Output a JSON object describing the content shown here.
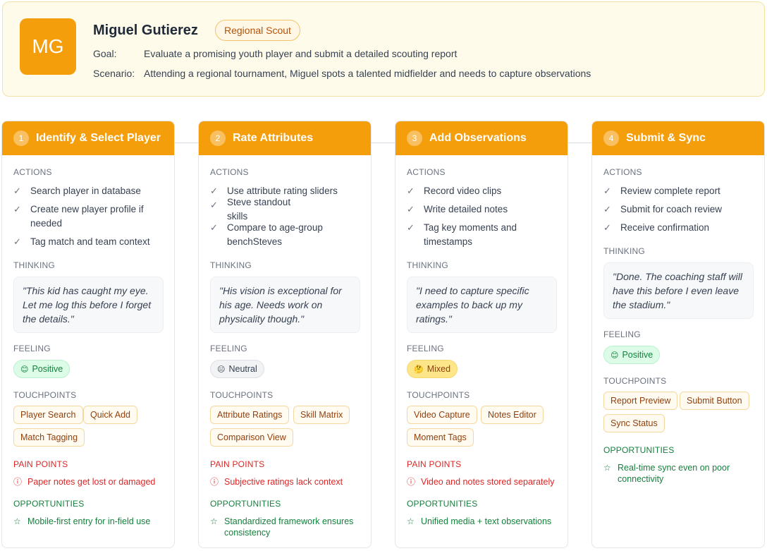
{
  "persona": {
    "initials": "MG",
    "name": "Miguel Gutierez",
    "role": "Regional Scout",
    "goal_label": "Goal:",
    "goal": "Evaluate a promising youth player and submit a detailed scouting report",
    "scenario_label": "Scenario:",
    "scenario": "Attending a regional tournament, Miguel spots a talented midfielder and needs to capture observations"
  },
  "labels": {
    "actions": "ACTIONS",
    "thinking": "THINKING",
    "feeling": "FEELING",
    "touchpoints": "TOUCHPOINTS",
    "pain_points": "PAIN POINTS",
    "opportunities": "OPPORTUNITIES"
  },
  "icons": {
    "check": "check-icon",
    "pain": "alert-circle-icon",
    "opportunity": "star-outline-icon"
  },
  "colors": {
    "accent": "#f59e0b",
    "pain": "#dc2626",
    "opportunity": "#15803d"
  },
  "stages": [
    {
      "number": "1",
      "title": "Identify & Select Player",
      "actions": [
        "Search player in database",
        "Create new player profile if needed",
        "Tag match and team context"
      ],
      "thinking": "\"This kid has caught my eye. Let me log this before I forget the details.\"",
      "feeling": "Positive",
      "feeling_emoji": "😊",
      "touchpoints": [
        "Player Search",
        "Quick Add",
        "Match Tagging"
      ],
      "pain_point": "Paper notes get lost or damaged",
      "opportunity": "Mobile-first entry for in-field use"
    },
    {
      "number": "2",
      "title": "Rate Attributes",
      "actions": [
        "Use attribute rating sliders",
        "Steve standout\nskills",
        "Compare to age-group benchSteves"
      ],
      "thinking": "\"His vision is exceptional for his age. Needs work on physicality though.\"",
      "feeling": "Neutral",
      "feeling_emoji": "😐",
      "touchpoints": [
        "Attribute Ratings",
        "Skill Matrix",
        "Comparison View"
      ],
      "pain_point": "Subjective ratings lack context",
      "opportunity": "Standardized framework ensures consistency"
    },
    {
      "number": "3",
      "title": "Add Observations",
      "actions": [
        "Record video clips",
        "Write detailed notes",
        "Tag key moments and timestamps"
      ],
      "thinking": "\"I need to capture specific examples to back up my ratings.\"",
      "feeling": "Mixed",
      "feeling_emoji": "🤔",
      "touchpoints": [
        "Video Capture",
        "Notes Editor",
        "Moment Tags"
      ],
      "pain_point": "Video and notes stored separately",
      "opportunity": "Unified media + text observations"
    },
    {
      "number": "4",
      "title": "Submit & Sync",
      "actions": [
        "Review complete report",
        "Submit for coach review",
        "Receive confirmation"
      ],
      "thinking": "\"Done. The coaching staff will have this before I even leave the stadium.\"",
      "feeling": "Positive",
      "feeling_emoji": "😊",
      "touchpoints": [
        "Report Preview",
        "Submit Button",
        "Sync Status"
      ],
      "opportunity": "Real-time sync even on poor connectivity"
    }
  ]
}
